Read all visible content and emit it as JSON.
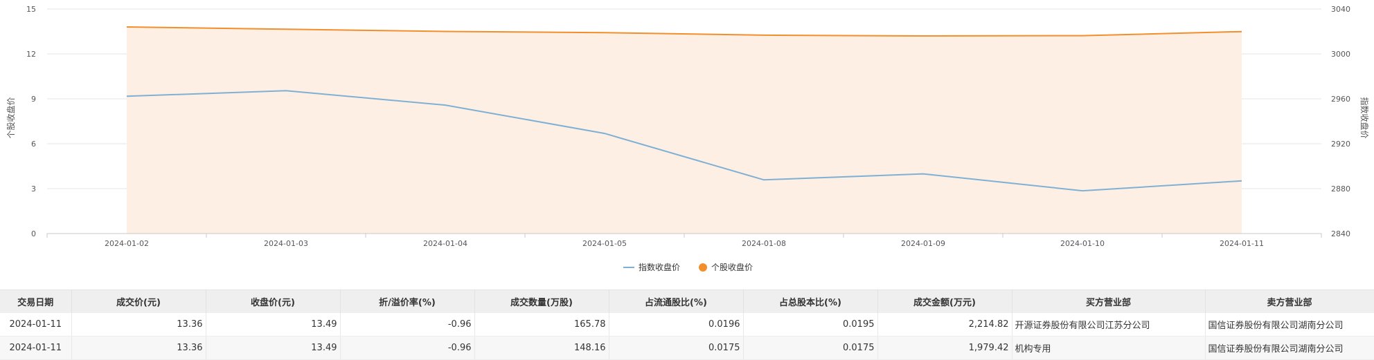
{
  "chart_data": {
    "type": "line",
    "x": [
      "2024-01-02",
      "2024-01-03",
      "2024-01-04",
      "2024-01-05",
      "2024-01-08",
      "2024-01-09",
      "2024-01-10",
      "2024-01-11"
    ],
    "series": [
      {
        "name": "指数收盘价",
        "axis": "right",
        "color": "#7eb0d5",
        "values": [
          2962.3,
          2967.2,
          2954.4,
          2929.2,
          2887.8,
          2893.2,
          2878.1,
          2886.9
        ]
      },
      {
        "name": "个股收盘价",
        "axis": "left",
        "color": "#f28e2b",
        "area_color": "#fdefe3",
        "values": [
          13.8,
          13.65,
          13.5,
          13.42,
          13.25,
          13.2,
          13.22,
          13.49
        ]
      }
    ],
    "y_left": {
      "label": "个股收盘价",
      "ticks": [
        0,
        3,
        6,
        9,
        12,
        15
      ],
      "ylim": [
        0,
        15
      ]
    },
    "y_right": {
      "label": "指数收盘价",
      "ticks": [
        2840,
        2880,
        2920,
        2960,
        3000,
        3040
      ],
      "ylim": [
        2840,
        3040
      ]
    },
    "grid": true,
    "legend_position": "bottom-center"
  },
  "table": {
    "headers": [
      "交易日期",
      "成交价(元)",
      "收盘价(元)",
      "折/溢价率(%)",
      "成交数量(万股)",
      "占流通股比(%)",
      "占总股本比(%)",
      "成交金额(万元)",
      "买方营业部",
      "卖方营业部"
    ],
    "rows": [
      [
        "2024-01-11",
        "13.36",
        "13.49",
        "-0.96",
        "165.78",
        "0.0196",
        "0.0195",
        "2,214.82",
        "开源证券股份有限公司江苏分公司",
        "国信证券股份有限公司湖南分公司"
      ],
      [
        "2024-01-11",
        "13.36",
        "13.49",
        "-0.96",
        "148.16",
        "0.0175",
        "0.0175",
        "1,979.42",
        "机构专用",
        "国信证券股份有限公司湖南分公司"
      ]
    ]
  }
}
